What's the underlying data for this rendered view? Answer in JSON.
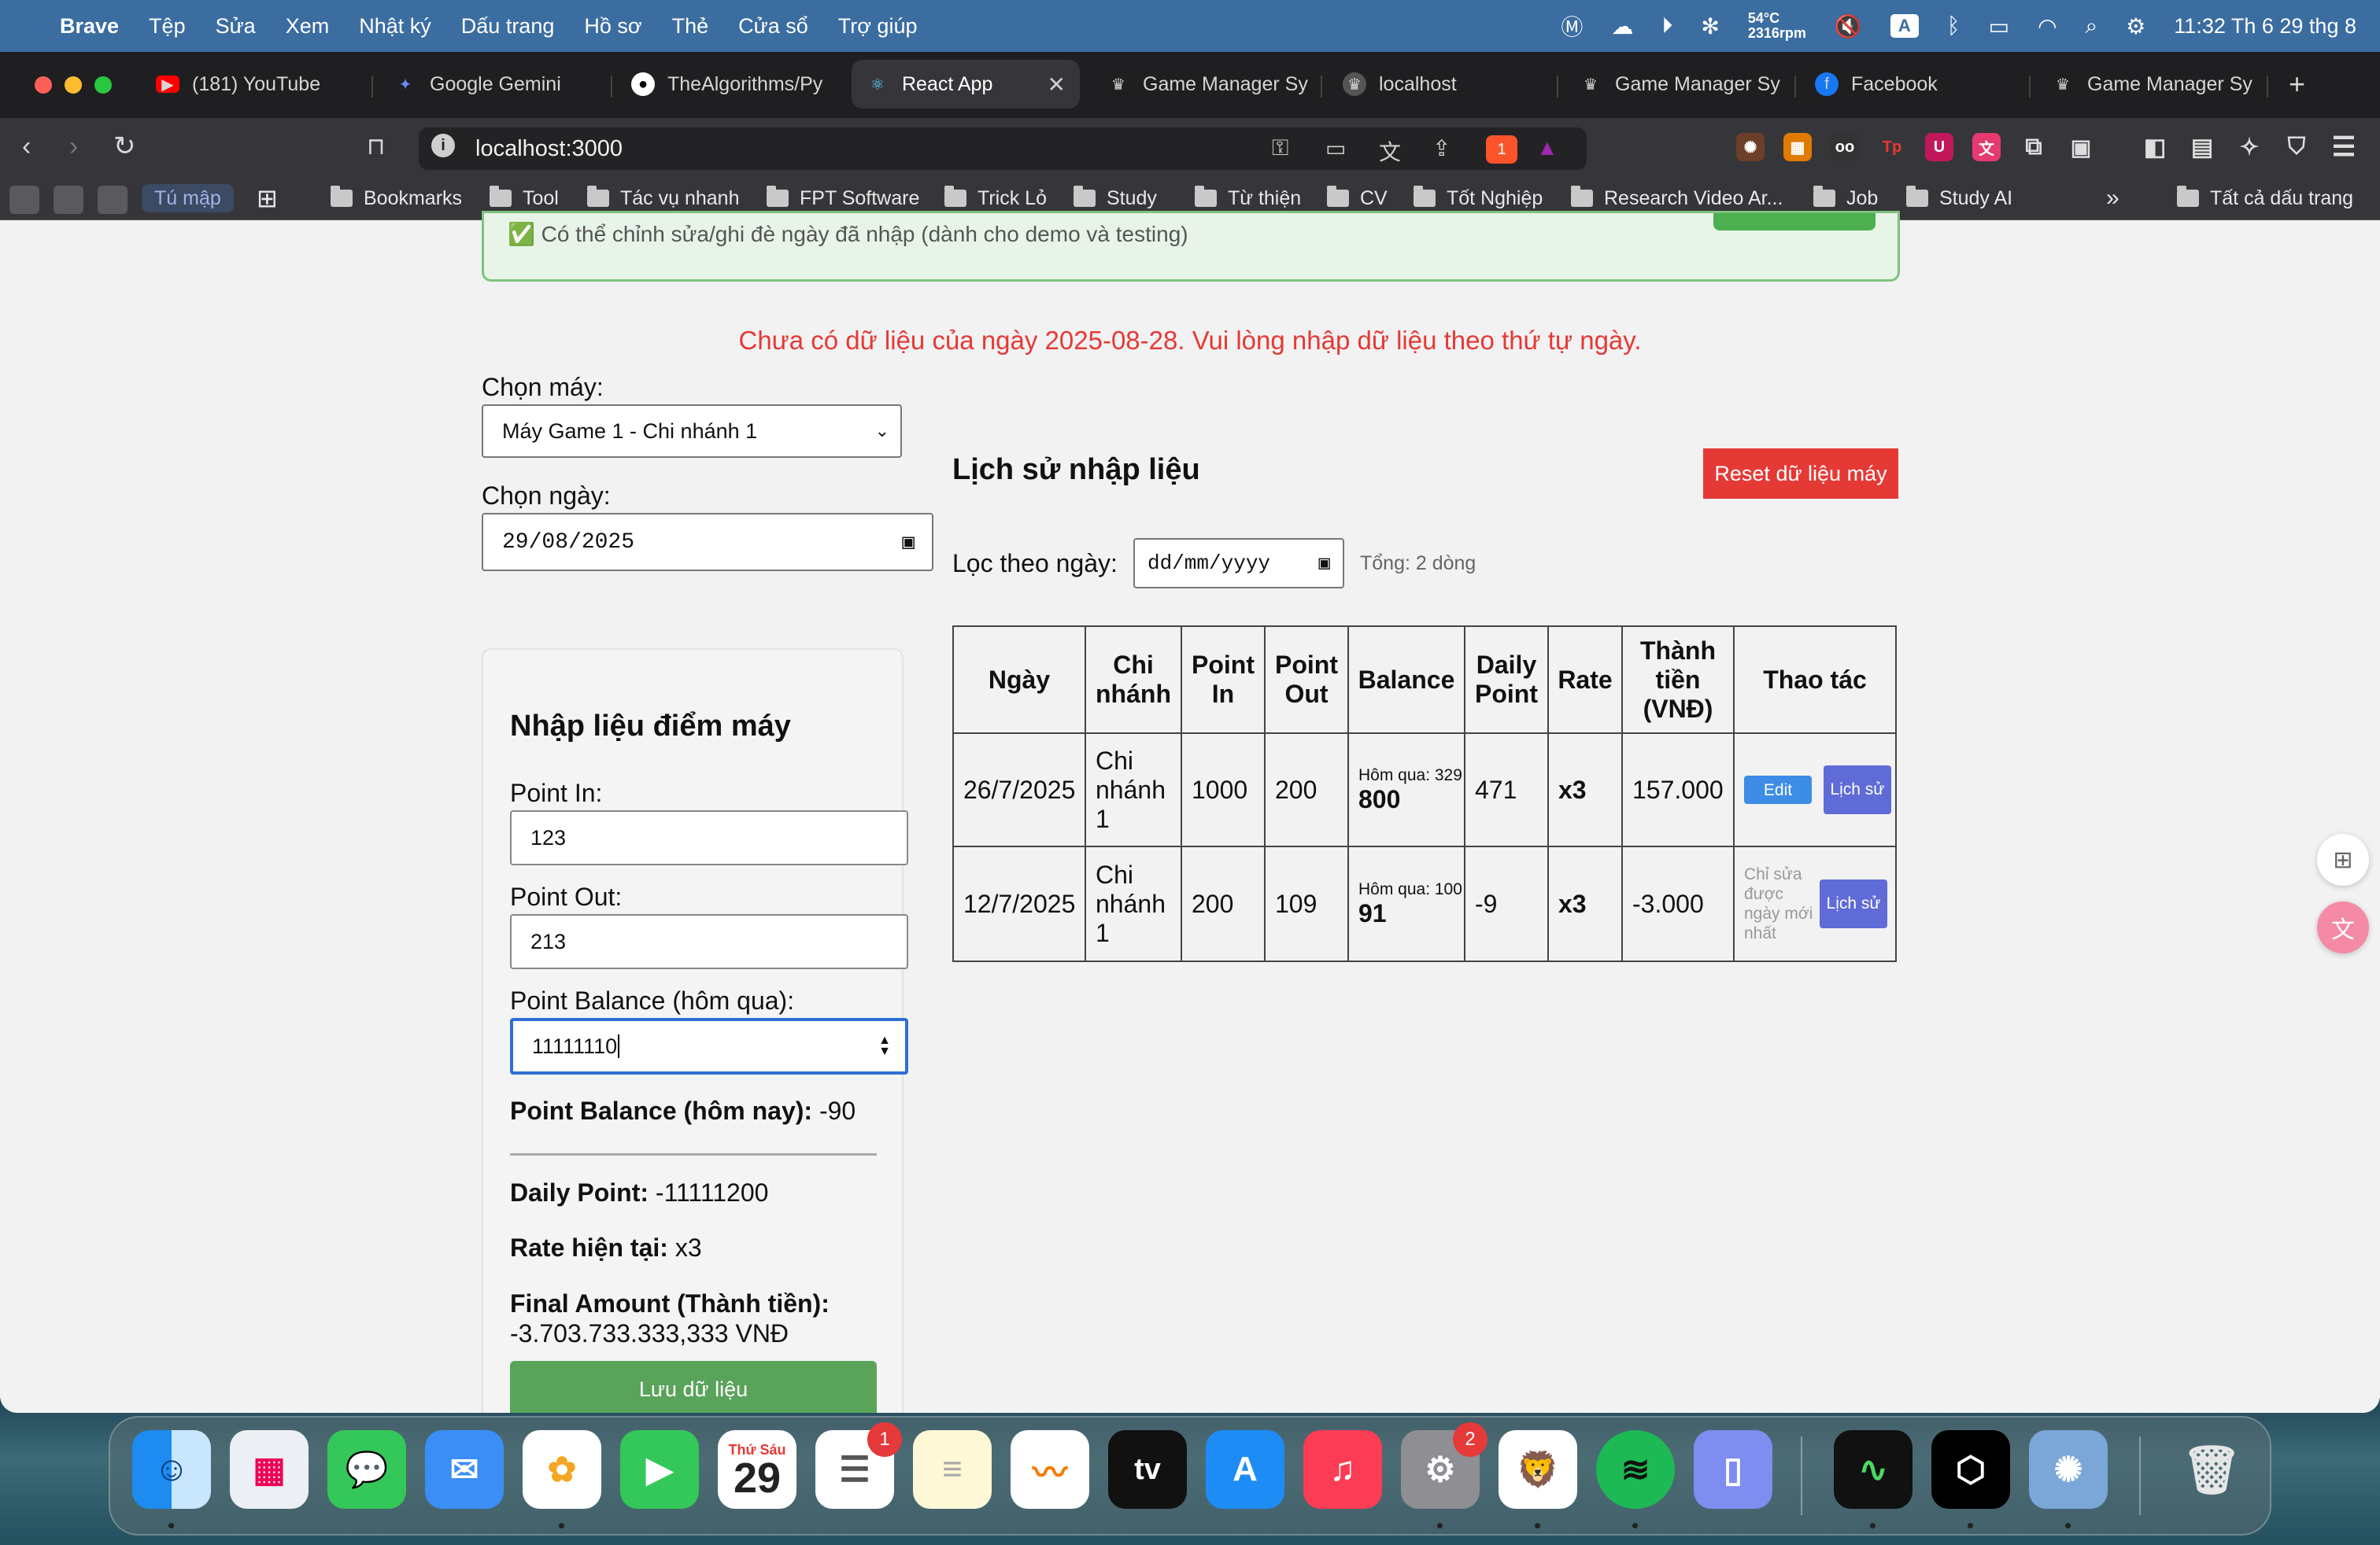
{
  "menubar": {
    "items": [
      "Brave",
      "Tệp",
      "Sửa",
      "Xem",
      "Nhật ký",
      "Dấu trang",
      "Hồ sơ",
      "Thẻ",
      "Cửa sổ",
      "Trợ giúp"
    ],
    "temp": "54°C",
    "rpm": "2316rpm",
    "input_source": "A",
    "clock": "11:32 Th 6 29 thg 8"
  },
  "tabs": [
    {
      "label": "(181) YouTube",
      "icon": "youtube-icon"
    },
    {
      "label": "Google Gemini",
      "icon": "gemini-icon"
    },
    {
      "label": "TheAlgorithms/Py",
      "icon": "github-icon"
    },
    {
      "label": "React App",
      "icon": "react-icon",
      "active": true
    },
    {
      "label": "Game Manager Sy",
      "icon": "crown-icon"
    },
    {
      "label": "localhost",
      "icon": "crown-icon"
    },
    {
      "label": "Game Manager Sy",
      "icon": "crown-icon"
    },
    {
      "label": "Facebook",
      "icon": "facebook-icon"
    },
    {
      "label": "Game Manager Sy",
      "icon": "crown-icon"
    }
  ],
  "address_bar": {
    "url": "localhost:3000",
    "shield_count": "1"
  },
  "bookmarks": {
    "tab_group": "Tú mập",
    "items": [
      "Bookmarks",
      "Tool",
      "Tác vụ nhanh",
      "FPT Software",
      "Trick Lỏ",
      "Study",
      "Từ thiện",
      "CV",
      "Tốt Nghiệp",
      "Research Video Ar...",
      "Job",
      "Study AI"
    ],
    "all_label": "Tất cả dấu trang"
  },
  "page": {
    "notice": "✅ Có thể chỉnh sửa/ghi đè ngày đã nhập (dành cho demo và testing)",
    "error": "Chưa có dữ liệu của ngày 2025-08-28. Vui lòng nhập dữ liệu theo thứ tự ngày.",
    "machine_label": "Chọn máy:",
    "machine_value": "Máy Game 1 - Chi nhánh 1",
    "date_label": "Chọn ngày:",
    "date_value": "29/08/2025",
    "form": {
      "title": "Nhập liệu điểm máy",
      "point_in_label": "Point In:",
      "point_in": "123",
      "point_out_label": "Point Out:",
      "point_out": "213",
      "balance_yday_label": "Point Balance (hôm qua):",
      "balance_yday": "11111110",
      "balance_today_label": "Point Balance (hôm nay):",
      "balance_today": "-90",
      "daily_label": "Daily Point:",
      "daily": "-11111200",
      "rate_label": "Rate hiện tại:",
      "rate": "x3",
      "final_label": "Final Amount (Thành tiền):",
      "final": "-3.703.733.333,333 VNĐ",
      "save": "Lưu dữ liệu"
    },
    "history": {
      "title": "Lịch sử nhập liệu",
      "reset": "Reset dữ liệu máy",
      "filter_label": "Lọc theo ngày:",
      "filter_placeholder": "dd/mm/yyyy",
      "total": "Tổng: 2 dòng",
      "headers": [
        "Ngày",
        "Chi nhánh",
        "Point In",
        "Point Out",
        "Balance",
        "Daily Point",
        "Rate",
        "Thành tiền (VNĐ)",
        "Thao tác"
      ],
      "rows": [
        {
          "date": "26/7/2025",
          "branch": "Chi nhánh 1",
          "in": "1000",
          "out": "200",
          "bal_prev": "Hôm qua: 329",
          "bal": "800",
          "daily": "471",
          "rate": "x3",
          "amount": "157.000",
          "edit": "Edit",
          "hist": "Lịch sử"
        },
        {
          "date": "12/7/2025",
          "branch": "Chi nhánh 1",
          "in": "200",
          "out": "109",
          "bal_prev": "Hôm qua: 100",
          "bal": "91",
          "daily": "-9",
          "rate": "x3",
          "amount": "-3.000",
          "note": "Chỉ sửa được ngày mới nhất",
          "hist": "Lịch sử"
        }
      ]
    }
  },
  "dock": {
    "calendar_month": "Thứ Sáu",
    "calendar_day": "29",
    "reminders_badge": "1",
    "settings_badge": "2",
    "tv_label": "tv"
  }
}
